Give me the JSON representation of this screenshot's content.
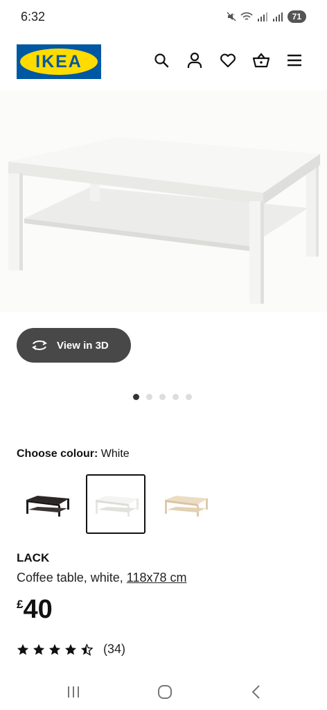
{
  "status_bar": {
    "time": "6:32",
    "battery": "71"
  },
  "header": {
    "logo_text": "IKEA",
    "icons": [
      "search-icon",
      "user-icon",
      "heart-icon",
      "basket-icon",
      "menu-icon"
    ],
    "brand_blue": "#0058a3",
    "brand_yellow": "#ffdb00"
  },
  "view_3d": {
    "label": "View in 3D"
  },
  "carousel": {
    "count": 5,
    "active_index": 0
  },
  "colour": {
    "label": "Choose colour:",
    "selected": "White",
    "options": [
      "black-brown",
      "white",
      "white stained oak effect"
    ]
  },
  "product": {
    "name": "LACK",
    "description": "Coffee table, white, ",
    "size": "118x78 cm",
    "currency": "£",
    "price": "40"
  },
  "rating": {
    "stars": 4.5,
    "count": "(34)"
  }
}
